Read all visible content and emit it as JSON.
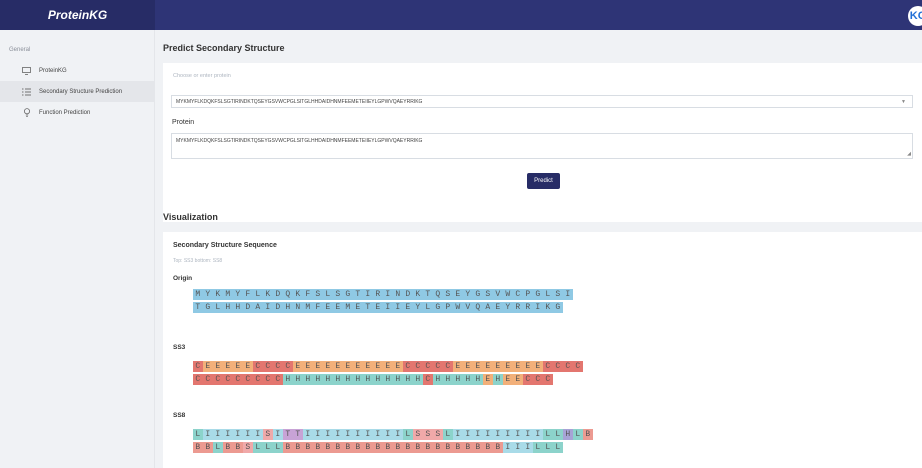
{
  "header": {
    "logo": "ProteinKG",
    "brand_icon": "KG"
  },
  "sidebar": {
    "group_label": "General",
    "items": [
      {
        "label": "ProteinKG",
        "icon": "monitor-icon"
      },
      {
        "label": "Secondary Structure Prediction",
        "icon": "list-icon",
        "active": true
      },
      {
        "label": "Function Prediction",
        "icon": "lightbulb-icon"
      }
    ]
  },
  "predict": {
    "title": "Predict Secondary Structure",
    "placeholder": "Choose or enter protein",
    "selected_protein": "MYKMYFLKDQKFSLSGTIRINDKTQSEYGSVWCPGLSITGLHHDAIDHNMFEEMETEIIEYLGPWVQAEYRRIKG",
    "protein_label": "Protein",
    "protein_value": "MYKMYFLKDQKFSLSGTIRINDKTQSEYGSVWCPGLSITGLHHDAIDHNMFEEMETEIIEYLGPWVQAEYRRIKG",
    "button_label": "Predict"
  },
  "visualization": {
    "title": "Visualization",
    "subtitle": "Secondary Structure Sequence",
    "hint": "Top: SS3 bottom: SS8",
    "origin_label": "Origin",
    "ss3_label": "SS3",
    "ss8_label": "SS8",
    "origin_rows": [
      "MYKMYFLKDQKFSLSGTIRINDKTQSEYGSVWCPGLSI",
      "TGLHHDAIDHNMFEEMETEIIEYLGPWVQAEYRRIKG"
    ],
    "ss3_rows": [
      "CEEEEECCCCEEEEEEEEEEECCCCCEEEEEEEEECCCC",
      "CCCCCCCCCHHHHHHHHHHHHHHCHHHHHEHEECCC"
    ],
    "ss8_rows": [
      "LIIIIIISITTIIIIIIIIIILSSSLIIIIIIIIILLHLB",
      "BBLBBSLLLBBBBBBBBBBBBBBBBBBBBBBIIILLL"
    ]
  },
  "colors": {
    "header": "#2e3476",
    "origin": "#8fc9e4",
    "ss3": {
      "C": "#e3766f",
      "E": "#f2b07a",
      "H": "#8cd3cb"
    },
    "ss8": {
      "L": "#8cd3cb",
      "I": "#a9dbe8",
      "S": "#f0a9a9",
      "T": "#c8a3d6",
      "B": "#ec9a91",
      "H": "#a7a3d6"
    }
  }
}
